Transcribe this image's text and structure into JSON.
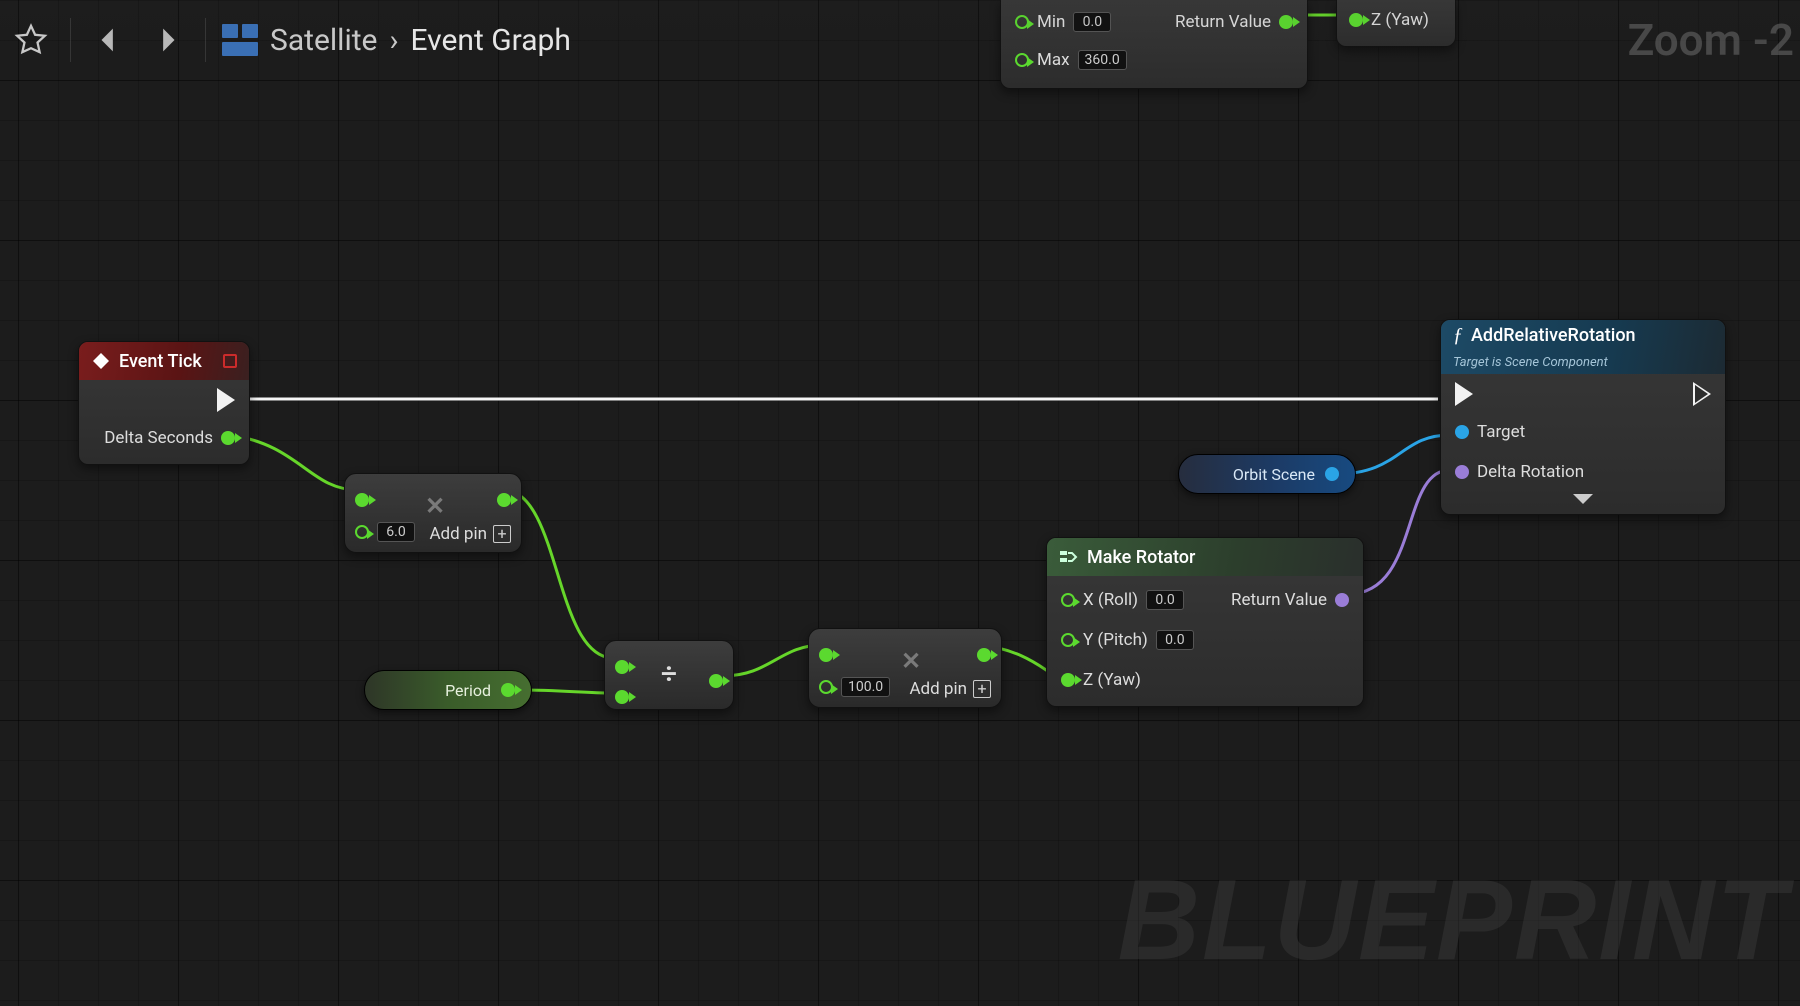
{
  "toolbar": {
    "breadcrumb_parent": "Satellite",
    "breadcrumb_current": "Event Graph"
  },
  "zoom_label": "Zoom -2",
  "watermark": "BLUEPRINT",
  "cut_node": {
    "min_label": "Min",
    "min_value": "0.0",
    "max_label": "Max",
    "max_value": "360.0",
    "return_label": "Return Value",
    "z_label": "Z (Yaw)"
  },
  "nodes": {
    "event_tick": {
      "title": "Event Tick",
      "delta_label": "Delta Seconds"
    },
    "mult": {
      "value": "6.0",
      "addpin": "Add pin"
    },
    "divide": {},
    "period": {
      "label": "Period"
    },
    "mult2": {
      "value": "100.0",
      "addpin": "Add pin"
    },
    "make_rotator": {
      "title": "Make Rotator",
      "x_label": "X (Roll)",
      "x_value": "0.0",
      "y_label": "Y (Pitch)",
      "y_value": "0.0",
      "z_label": "Z (Yaw)",
      "return_label": "Return Value"
    },
    "orbit": {
      "label": "Orbit Scene"
    },
    "add_rel": {
      "title": "AddRelativeRotation",
      "subtitle": "Target is Scene Component",
      "target_label": "Target",
      "delta_label": "Delta Rotation"
    }
  }
}
